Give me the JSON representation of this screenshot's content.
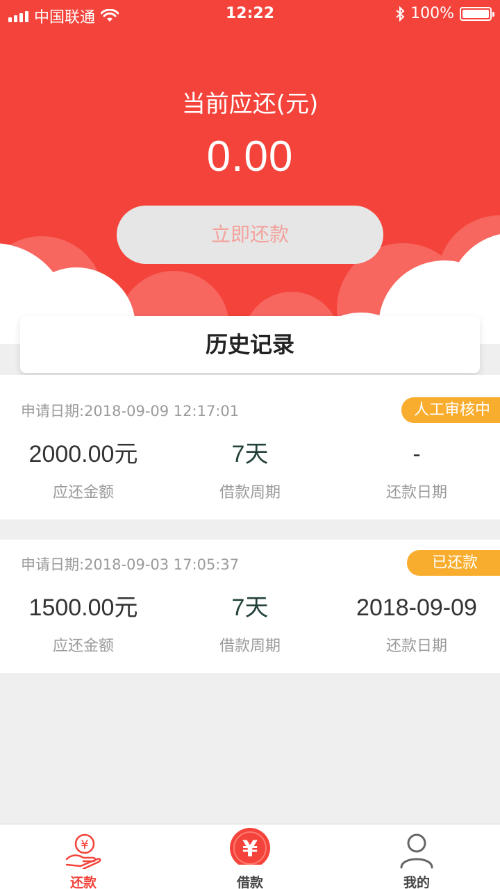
{
  "status_bar": {
    "carrier": "中国联通",
    "time": "12:22",
    "battery": "100%",
    "icons": [
      "signal-icon",
      "wifi-icon",
      "bluetooth-icon",
      "battery-icon"
    ]
  },
  "hero": {
    "title": "当前应还(元)",
    "amount": "0.00",
    "repay_button": "立即还款"
  },
  "history": {
    "title": "历史记录"
  },
  "records": [
    {
      "date": "申请日期:2018-09-09 12:17:01",
      "badge": "人工审核中",
      "amount": "2000.00元",
      "amount_label": "应还金额",
      "period": "7天",
      "period_label": "借款周期",
      "repay_date": "-",
      "repay_date_label": "还款日期"
    },
    {
      "date": "申请日期:2018-09-03 17:05:37",
      "badge": "已还款",
      "amount": "1500.00元",
      "amount_label": "应还金额",
      "period": "7天",
      "period_label": "借款周期",
      "repay_date": "2018-09-09",
      "repay_date_label": "还款日期"
    }
  ],
  "tabs": [
    {
      "label": "还款",
      "icon": "hand-yen-icon",
      "active": true
    },
    {
      "label": "借款",
      "icon": "yen-circle-icon",
      "active": false
    },
    {
      "label": "我的",
      "icon": "user-icon",
      "active": false
    }
  ],
  "colors": {
    "primary": "#f4433a",
    "badge": "#f9ad2e",
    "background": "#efefef"
  }
}
